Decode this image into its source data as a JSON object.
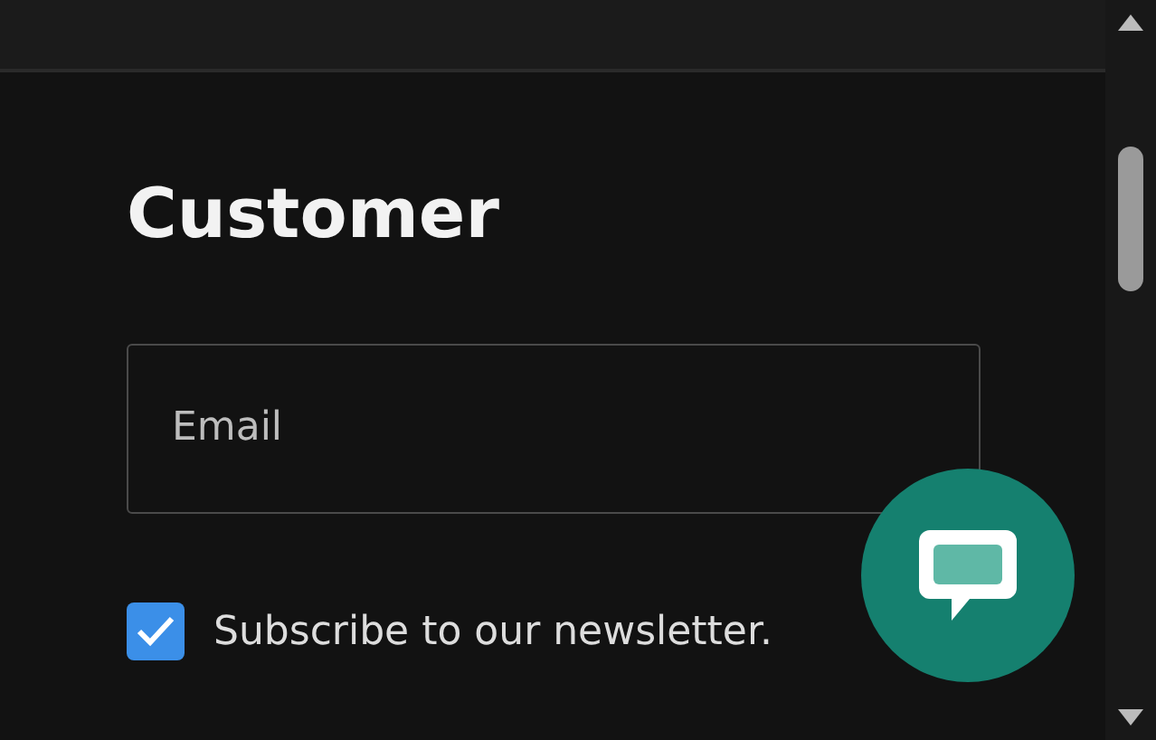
{
  "heading": "Customer",
  "email": {
    "placeholder": "Email"
  },
  "newsletter": {
    "label": "Subscribe to our newsletter.",
    "checked": true
  }
}
